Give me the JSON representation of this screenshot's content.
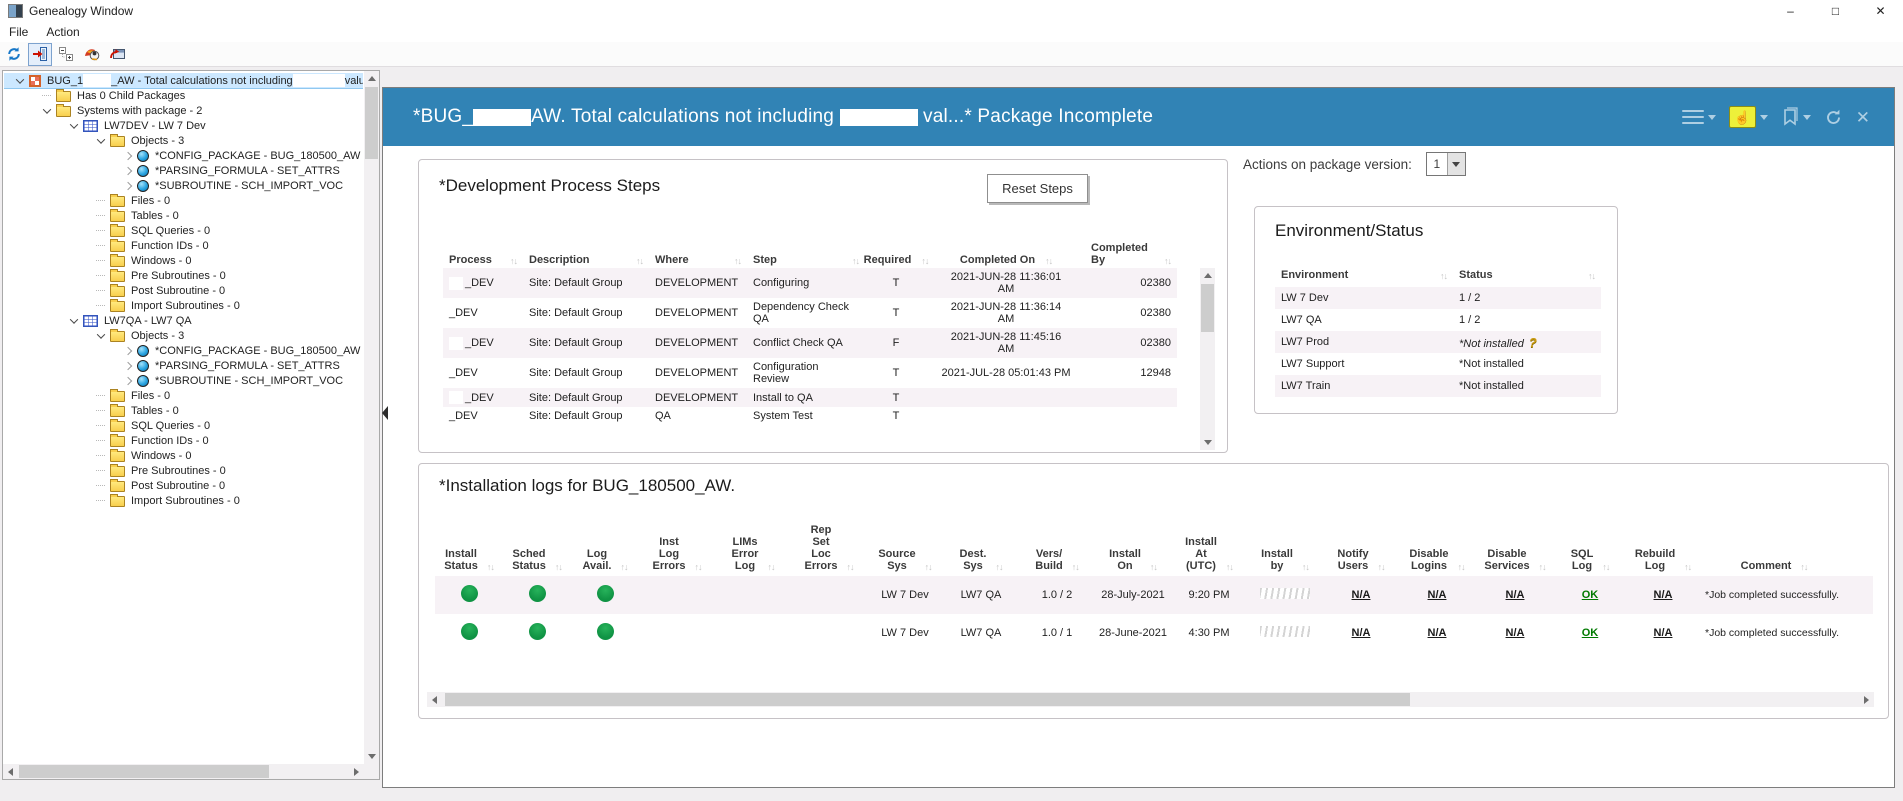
{
  "colors": {
    "header_blue": "#3183b5",
    "status_green": "#109344",
    "ok_green": "#007a00",
    "selection_blue": "#cce8ff",
    "row_alt": "#f7f2f6",
    "highlight_yellow": "#edf03a"
  },
  "window": {
    "title": "Genealogy Window",
    "controls": {
      "minimize": "–",
      "maximize": "□",
      "close": "✕"
    }
  },
  "menu": {
    "items": [
      "File",
      "Action"
    ]
  },
  "toolbar": {
    "icons": [
      "refresh",
      "exit-door",
      "expand-tree",
      "genealogy",
      "send-to-window"
    ]
  },
  "tree": {
    "items": [
      {
        "level": 0,
        "icon": "package",
        "chevron": "expanded",
        "selected": true,
        "label_parts": [
          {
            "t": "BUG_1"
          },
          {
            "r": 28
          },
          {
            "t": "_AW - Total calculations not including"
          },
          {
            "r": 52
          },
          {
            "t": "valu"
          }
        ]
      },
      {
        "level": 1,
        "icon": "folder",
        "label": "Has 0 Child Packages"
      },
      {
        "level": 1,
        "icon": "folder",
        "chevron": "expanded",
        "label": "Systems with package - 2"
      },
      {
        "level": 2,
        "icon": "system",
        "chevron": "expanded",
        "label": "LW7DEV - LW 7 Dev"
      },
      {
        "level": 3,
        "icon": "folder",
        "chevron": "expanded",
        "label": "Objects - 3"
      },
      {
        "level": 4,
        "icon": "object",
        "chevron": "collapsed",
        "label": "*CONFIG_PACKAGE - BUG_180500_AW"
      },
      {
        "level": 4,
        "icon": "object",
        "chevron": "collapsed",
        "label": "*PARSING_FORMULA - SET_ATTRS"
      },
      {
        "level": 4,
        "icon": "object",
        "chevron": "collapsed",
        "label": "*SUBROUTINE - SCH_IMPORT_VOC"
      },
      {
        "level": 3,
        "icon": "folder",
        "label": "Files - 0"
      },
      {
        "level": 3,
        "icon": "folder",
        "label": "Tables - 0"
      },
      {
        "level": 3,
        "icon": "folder",
        "label": "SQL Queries - 0"
      },
      {
        "level": 3,
        "icon": "folder",
        "label": "Function IDs - 0"
      },
      {
        "level": 3,
        "icon": "folder",
        "label": "Windows - 0"
      },
      {
        "level": 3,
        "icon": "folder",
        "label": "Pre Subroutines - 0"
      },
      {
        "level": 3,
        "icon": "folder",
        "label": "Post Subroutine - 0"
      },
      {
        "level": 3,
        "icon": "folder",
        "label": "Import Subroutines - 0"
      },
      {
        "level": 2,
        "icon": "system",
        "chevron": "expanded",
        "label": "LW7QA - LW7 QA"
      },
      {
        "level": 3,
        "icon": "folder",
        "chevron": "expanded",
        "label": "Objects - 3"
      },
      {
        "level": 4,
        "icon": "object",
        "chevron": "collapsed",
        "label": "*CONFIG_PACKAGE - BUG_180500_AW"
      },
      {
        "level": 4,
        "icon": "object",
        "chevron": "collapsed",
        "label": "*PARSING_FORMULA - SET_ATTRS"
      },
      {
        "level": 4,
        "icon": "object",
        "chevron": "collapsed",
        "label": "*SUBROUTINE - SCH_IMPORT_VOC"
      },
      {
        "level": 3,
        "icon": "folder",
        "label": "Files - 0"
      },
      {
        "level": 3,
        "icon": "folder",
        "label": "Tables - 0"
      },
      {
        "level": 3,
        "icon": "folder",
        "label": "SQL Queries - 0"
      },
      {
        "level": 3,
        "icon": "folder",
        "label": "Function IDs - 0"
      },
      {
        "level": 3,
        "icon": "folder",
        "label": "Windows - 0"
      },
      {
        "level": 3,
        "icon": "folder",
        "label": "Pre Subroutines - 0"
      },
      {
        "level": 3,
        "icon": "folder",
        "label": "Post Subroutine - 0"
      },
      {
        "level": 3,
        "icon": "folder",
        "label": "Import Subroutines - 0"
      }
    ]
  },
  "header": {
    "title_parts": [
      {
        "t": "*BUG_"
      },
      {
        "r": 58
      },
      {
        "t": "AW. Total calculations not including "
      },
      {
        "r": 78
      },
      {
        "t": " val...* Package Incomplete"
      }
    ],
    "icons": [
      "menu",
      "run-action",
      "bookmark",
      "refresh",
      "close"
    ]
  },
  "actions_bar": {
    "label": "Actions on package version:",
    "version": "1"
  },
  "dev_steps": {
    "title": "*Development Process Steps",
    "reset_button": "Reset Steps",
    "columns": [
      "Process",
      "Description",
      "Where",
      "Step",
      "Required",
      "Completed On",
      "Completed\nBy"
    ],
    "rows": [
      {
        "redact": true,
        "cells": [
          "_DEV",
          "Site: Default Group",
          "DEVELOPMENT",
          "Configuring",
          "T",
          "2021-JUN-28 11:36:01\nAM",
          "02380"
        ]
      },
      {
        "redact": false,
        "cells": [
          "_DEV",
          "Site: Default Group",
          "DEVELOPMENT",
          "Dependency Check\nQA",
          "T",
          "2021-JUN-28 11:36:14\nAM",
          "02380"
        ]
      },
      {
        "redact": true,
        "cells": [
          "_DEV",
          "Site: Default Group",
          "DEVELOPMENT",
          "Conflict Check QA",
          "F",
          "2021-JUN-28 11:45:16\nAM",
          "02380"
        ]
      },
      {
        "redact": false,
        "cells": [
          "_DEV",
          "Site: Default Group",
          "DEVELOPMENT",
          "Configuration\nReview",
          "T",
          "2021-JUL-28 05:01:43 PM",
          "12948"
        ]
      },
      {
        "redact": true,
        "cells": [
          "_DEV",
          "Site: Default Group",
          "DEVELOPMENT",
          "Install to QA",
          "T",
          "",
          ""
        ]
      },
      {
        "redact": false,
        "cells": [
          "_DEV",
          "Site: Default Group",
          "QA",
          "System Test",
          "T",
          "",
          ""
        ]
      }
    ]
  },
  "env_status": {
    "title": "Environment/Status",
    "columns": [
      "Environment",
      "Status"
    ],
    "rows": [
      {
        "environment": "LW 7 Dev",
        "status": "1 / 2",
        "italic": false,
        "question_icon": false
      },
      {
        "environment": "LW7 QA",
        "status": "1 / 2",
        "italic": false,
        "question_icon": false
      },
      {
        "environment": "LW7 Prod",
        "status": "*Not installed",
        "italic": true,
        "question_icon": true
      },
      {
        "environment": "LW7 Support",
        "status": "*Not installed",
        "italic": false,
        "question_icon": false
      },
      {
        "environment": "LW7 Train",
        "status": "*Not installed",
        "italic": false,
        "question_icon": false
      }
    ]
  },
  "install_logs": {
    "title": "*Installation logs for BUG_180500_AW.",
    "columns": [
      "Install\nStatus",
      "Sched\nStatus",
      "Log\nAvail.",
      "Inst\nLog\nErrors",
      "LIMs\nError\nLog",
      "Rep\nSet\nLoc\nErrors",
      "Source\nSys",
      "Dest.\nSys",
      "Vers/\nBuild",
      "Install\nOn",
      "Install\nAt\n(UTC)",
      "Install\nby",
      "Notify\nUsers",
      "Disable\nLogins",
      "Disable\nServices",
      "SQL\nLog",
      "Rebuild\nLog",
      "Comment"
    ],
    "rows": [
      {
        "cells": [
          {
            "k": "dot"
          },
          {
            "k": "dot"
          },
          {
            "k": "dot"
          },
          {
            "k": "t",
            "v": ""
          },
          {
            "k": "t",
            "v": ""
          },
          {
            "k": "t",
            "v": ""
          },
          {
            "k": "t",
            "v": "LW 7 Dev"
          },
          {
            "k": "t",
            "v": "LW7 QA"
          },
          {
            "k": "t",
            "v": "1.0 / 2"
          },
          {
            "k": "t",
            "v": "28-July-2021"
          },
          {
            "k": "t",
            "v": "9:20 PM"
          },
          {
            "k": "redacted"
          },
          {
            "k": "link",
            "v": "N/A"
          },
          {
            "k": "link",
            "v": "N/A"
          },
          {
            "k": "link",
            "v": "N/A"
          },
          {
            "k": "ok",
            "v": "OK"
          },
          {
            "k": "link",
            "v": "N/A"
          },
          {
            "k": "t",
            "v": "*Job completed successfully."
          }
        ]
      },
      {
        "cells": [
          {
            "k": "dot"
          },
          {
            "k": "dot"
          },
          {
            "k": "dot"
          },
          {
            "k": "t",
            "v": ""
          },
          {
            "k": "t",
            "v": ""
          },
          {
            "k": "t",
            "v": ""
          },
          {
            "k": "t",
            "v": "LW 7 Dev"
          },
          {
            "k": "t",
            "v": "LW7 QA"
          },
          {
            "k": "t",
            "v": "1.0 / 1"
          },
          {
            "k": "t",
            "v": "28-June-2021"
          },
          {
            "k": "t",
            "v": "4:30 PM"
          },
          {
            "k": "redacted"
          },
          {
            "k": "link",
            "v": "N/A"
          },
          {
            "k": "link",
            "v": "N/A"
          },
          {
            "k": "link",
            "v": "N/A"
          },
          {
            "k": "ok",
            "v": "OK"
          },
          {
            "k": "link",
            "v": "N/A"
          },
          {
            "k": "t",
            "v": "*Job completed successfully."
          }
        ]
      }
    ]
  }
}
